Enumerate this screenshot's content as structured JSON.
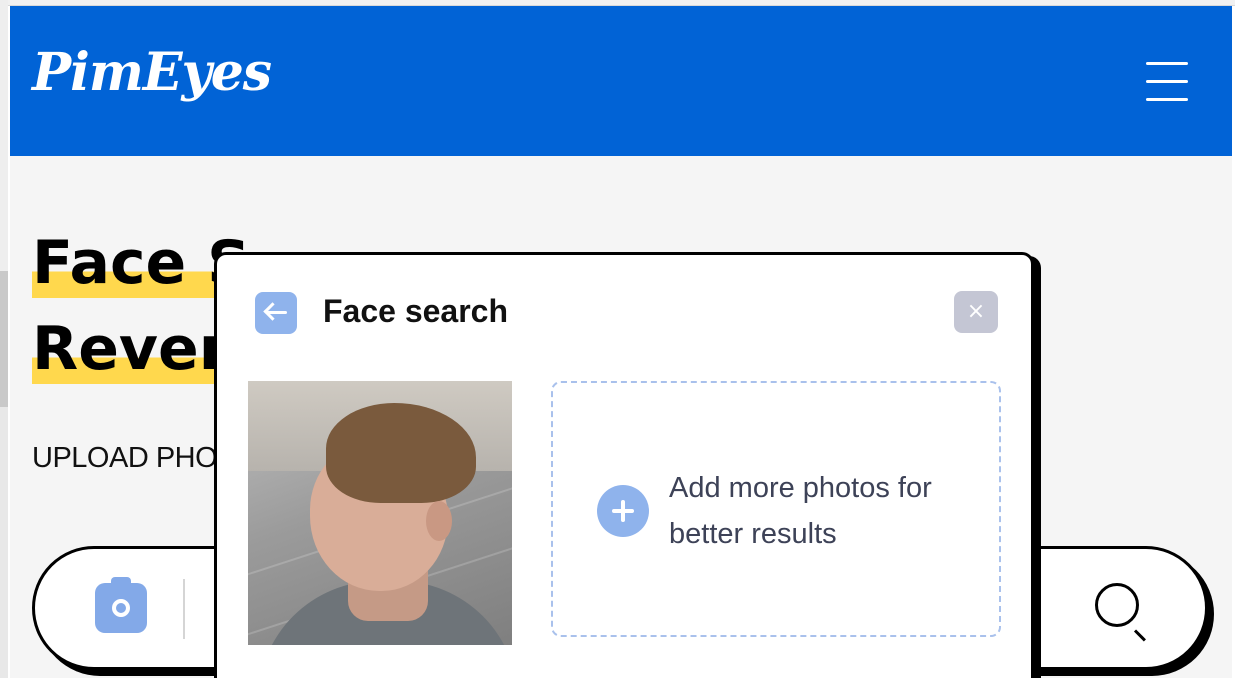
{
  "header": {
    "logo_text": "PimEyes",
    "menu_icon": "hamburger-menu-icon",
    "background_color": "#0163d6"
  },
  "hero": {
    "title_line1": "Face S",
    "title_line2": "Rever",
    "subtitle": "UPLOAD PHO",
    "highlight_color": "#ffd84d"
  },
  "search_bar": {
    "camera_icon": "camera-icon",
    "search_icon": "magnifier-icon"
  },
  "modal": {
    "title": "Face search",
    "back_icon": "arrow-left-icon",
    "close_icon": "close-icon",
    "close_glyph": "×",
    "add_more_text": "Add more photos for better results",
    "add_icon": "plus-circle-icon",
    "accent_color": "#8fb3ec"
  }
}
